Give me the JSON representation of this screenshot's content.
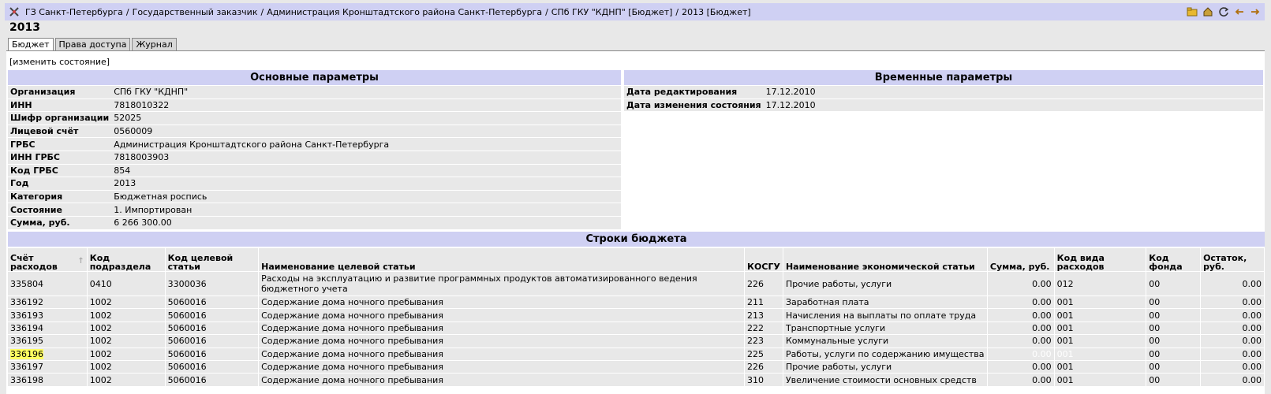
{
  "breadcrumbs": [
    "ГЗ Санкт-Петербурга",
    "Государственный заказчик",
    "Администрация Кронштадтского района Санкт-Петербурга",
    "СПб ГКУ \"КДНП\" [Бюджет]",
    "2013 [Бюджет]"
  ],
  "page_title": "2013",
  "tabs": [
    "Бюджет",
    "Права доступа",
    "Журнал"
  ],
  "change_state_link": "[изменить состояние]",
  "main_params": {
    "title": "Основные параметры",
    "rows": [
      {
        "key": "Организация",
        "value": "СПб ГКУ \"КДНП\""
      },
      {
        "key": "ИНН",
        "value": "7818010322"
      },
      {
        "key": "Шифр организации",
        "value": "52025"
      },
      {
        "key": "Лицевой счёт",
        "value": "0560009"
      },
      {
        "key": "ГРБС",
        "value": "Администрация Кронштадтского района Санкт-Петербурга"
      },
      {
        "key": "ИНН ГРБС",
        "value": "7818003903"
      },
      {
        "key": "Код ГРБС",
        "value": "854"
      },
      {
        "key": "Год",
        "value": "2013"
      },
      {
        "key": "Категория",
        "value": "Бюджетная роспись"
      },
      {
        "key": "Состояние",
        "value": "1. Импортирован"
      },
      {
        "key": "Сумма, руб.",
        "value": "6 266 300.00"
      }
    ]
  },
  "time_params": {
    "title": "Временные параметры",
    "rows": [
      {
        "key": "Дата редактирования",
        "value": "17.12.2010"
      },
      {
        "key": "Дата изменения состояния",
        "value": "17.12.2010"
      }
    ]
  },
  "budget_rows": {
    "title": "Строки бюджета",
    "columns": [
      "Счёт расходов",
      "Код подраздела",
      "Код целевой статьи",
      "Наименование целевой статьи",
      "КОСГУ",
      "Наименование экономической статьи",
      "Сумма, руб.",
      "Код вида расходов",
      "Код фонда",
      "Остаток, руб."
    ],
    "rows": [
      [
        "335804",
        "0410",
        "3300036",
        "Расходы на эксплуатацию и развитие программных продуктов автоматизированного ведения бюджетного учета",
        "226",
        "Прочие работы, услуги",
        "0.00",
        "012",
        "00",
        "0.00"
      ],
      [
        "336192",
        "1002",
        "5060016",
        "Содержание дома ночного пребывания",
        "211",
        "Заработная плата",
        "0.00",
        "001",
        "00",
        "0.00"
      ],
      [
        "336193",
        "1002",
        "5060016",
        "Содержание дома ночного пребывания",
        "213",
        "Начисления на выплаты по оплате труда",
        "0.00",
        "001",
        "00",
        "0.00"
      ],
      [
        "336194",
        "1002",
        "5060016",
        "Содержание дома ночного пребывания",
        "222",
        "Транспортные услуги",
        "0.00",
        "001",
        "00",
        "0.00"
      ],
      [
        "336195",
        "1002",
        "5060016",
        "Содержание дома ночного пребывания",
        "223",
        "Коммунальные услуги",
        "0.00",
        "001",
        "00",
        "0.00"
      ],
      [
        "336196",
        "1002",
        "5060016",
        "Содержание дома ночного пребывания",
        "225",
        "Работы, услуги по содержанию имущества",
        "0.00",
        "001",
        "00",
        "0.00"
      ],
      [
        "336197",
        "1002",
        "5060016",
        "Содержание дома ночного пребывания",
        "226",
        "Прочие работы, услуги",
        "0.00",
        "001",
        "00",
        "0.00"
      ],
      [
        "336198",
        "1002",
        "5060016",
        "Содержание дома ночного пребывания",
        "310",
        "Увеличение стоимости основных средств",
        "0.00",
        "001",
        "00",
        "0.00"
      ]
    ]
  }
}
